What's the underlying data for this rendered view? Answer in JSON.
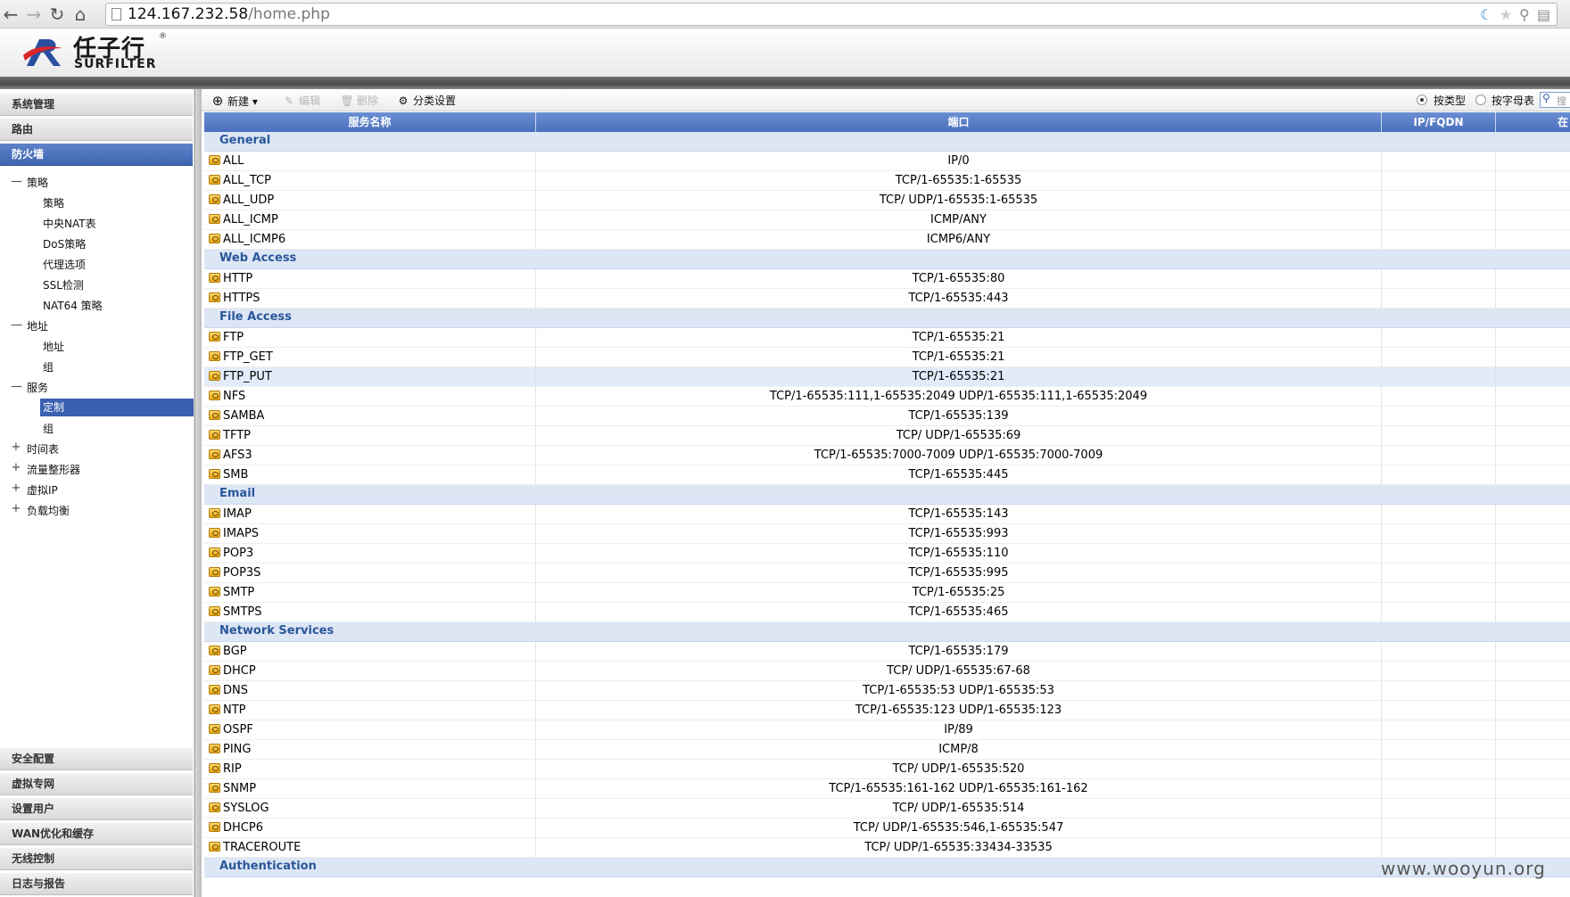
{
  "browser": {
    "url_host": "124.167.232.58",
    "url_path": "/home.php"
  },
  "header": {
    "logo_cn": "任子行",
    "logo_en": "SURFILTER",
    "logo_reg": "®"
  },
  "sidebar": {
    "top_sections": [
      "系统管理",
      "路由",
      "防火墙"
    ],
    "active_section": "防火墙",
    "tree": {
      "policy": {
        "label": "策略",
        "children": [
          "策略",
          "中央NAT表",
          "DoS策略",
          "代理选项",
          "SSL检测",
          "NAT64 策略"
        ]
      },
      "address": {
        "label": "地址",
        "children": [
          "地址",
          "组"
        ]
      },
      "service": {
        "label": "服务",
        "children": [
          "定制",
          "组"
        ],
        "selected": "定制"
      },
      "collapsed": [
        "时间表",
        "流量整形器",
        "虚拟IP",
        "负载均衡"
      ]
    },
    "bottom_sections": [
      "安全配置",
      "虚拟专网",
      "设置用户",
      "WAN优化和缓存",
      "无线控制",
      "日志与报告"
    ]
  },
  "toolbar": {
    "new_label": "新建",
    "edit_label": "编辑",
    "delete_label": "删除",
    "category_label": "分类设置",
    "by_type_label": "按类型",
    "by_alpha_label": "按字母表",
    "search_placeholder": "搜"
  },
  "table": {
    "columns": [
      "服务名称",
      "端口",
      "IP/FQDN",
      "在"
    ],
    "groups": [
      {
        "name": "General",
        "rows": [
          {
            "name": "ALL",
            "port": "IP/0"
          },
          {
            "name": "ALL_TCP",
            "port": "TCP/1-65535:1-65535"
          },
          {
            "name": "ALL_UDP",
            "port": "TCP/ UDP/1-65535:1-65535"
          },
          {
            "name": "ALL_ICMP",
            "port": "ICMP/ANY"
          },
          {
            "name": "ALL_ICMP6",
            "port": "ICMP6/ANY"
          }
        ]
      },
      {
        "name": "Web Access",
        "rows": [
          {
            "name": "HTTP",
            "port": "TCP/1-65535:80"
          },
          {
            "name": "HTTPS",
            "port": "TCP/1-65535:443"
          }
        ]
      },
      {
        "name": "File Access",
        "rows": [
          {
            "name": "FTP",
            "port": "TCP/1-65535:21"
          },
          {
            "name": "FTP_GET",
            "port": "TCP/1-65535:21"
          },
          {
            "name": "FTP_PUT",
            "port": "TCP/1-65535:21",
            "highlight": true
          },
          {
            "name": "NFS",
            "port": "TCP/1-65535:111,1-65535:2049 UDP/1-65535:111,1-65535:2049"
          },
          {
            "name": "SAMBA",
            "port": "TCP/1-65535:139"
          },
          {
            "name": "TFTP",
            "port": "TCP/ UDP/1-65535:69"
          },
          {
            "name": "AFS3",
            "port": "TCP/1-65535:7000-7009 UDP/1-65535:7000-7009"
          },
          {
            "name": "SMB",
            "port": "TCP/1-65535:445"
          }
        ]
      },
      {
        "name": "Email",
        "rows": [
          {
            "name": "IMAP",
            "port": "TCP/1-65535:143"
          },
          {
            "name": "IMAPS",
            "port": "TCP/1-65535:993"
          },
          {
            "name": "POP3",
            "port": "TCP/1-65535:110"
          },
          {
            "name": "POP3S",
            "port": "TCP/1-65535:995"
          },
          {
            "name": "SMTP",
            "port": "TCP/1-65535:25"
          },
          {
            "name": "SMTPS",
            "port": "TCP/1-65535:465"
          }
        ]
      },
      {
        "name": "Network Services",
        "rows": [
          {
            "name": "BGP",
            "port": "TCP/1-65535:179"
          },
          {
            "name": "DHCP",
            "port": "TCP/ UDP/1-65535:67-68"
          },
          {
            "name": "DNS",
            "port": "TCP/1-65535:53 UDP/1-65535:53"
          },
          {
            "name": "NTP",
            "port": "TCP/1-65535:123 UDP/1-65535:123"
          },
          {
            "name": "OSPF",
            "port": "IP/89"
          },
          {
            "name": "PING",
            "port": "ICMP/8"
          },
          {
            "name": "RIP",
            "port": "TCP/ UDP/1-65535:520"
          },
          {
            "name": "SNMP",
            "port": "TCP/1-65535:161-162 UDP/1-65535:161-162"
          },
          {
            "name": "SYSLOG",
            "port": "TCP/ UDP/1-65535:514"
          },
          {
            "name": "DHCP6",
            "port": "TCP/ UDP/1-65535:546,1-65535:547"
          },
          {
            "name": "TRACEROUTE",
            "port": "TCP/ UDP/1-65535:33434-33535"
          }
        ]
      },
      {
        "name": "Authentication",
        "rows": []
      }
    ]
  },
  "watermark": "www.wooyun.org"
}
